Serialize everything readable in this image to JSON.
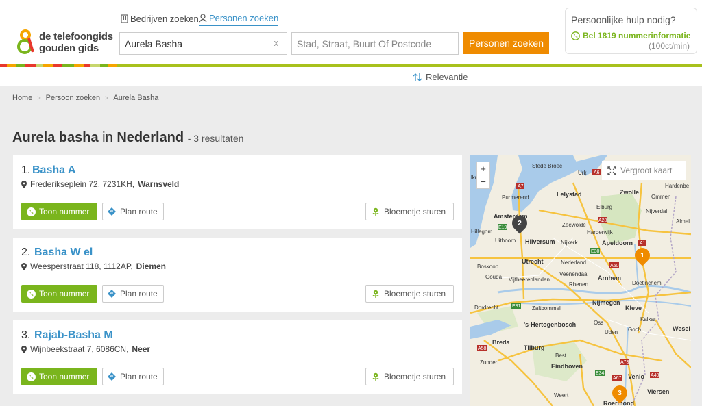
{
  "logo": {
    "line1": "de telefoongids",
    "line2": "gouden gids"
  },
  "tabs": [
    {
      "label": "Bedrijven zoeken",
      "icon": "building-icon",
      "active": false
    },
    {
      "label": "Personen zoeken",
      "icon": "person-icon",
      "active": true
    }
  ],
  "search": {
    "query_value": "Aurela Basha",
    "clear_label": "x",
    "location_placeholder": "Stad, Straat, Buurt Of Postcode",
    "button_label": "Personen zoeken"
  },
  "help": {
    "title": "Persoonlijke hulp nodig?",
    "link_label": "Bel 1819 nummerinformatie",
    "cost": "(100ct/min)"
  },
  "sort": {
    "label": "Relevantie"
  },
  "breadcrumb": [
    "Home",
    "Persoon zoeken",
    "Aurela Basha"
  ],
  "heading": {
    "name": "Aurela basha",
    "in": "in",
    "country": "Nederland",
    "count": "- 3 resultaten"
  },
  "results": [
    {
      "num": "1.",
      "name": "Basha A",
      "street": "Frederikseplein 72, 7231KH,",
      "city": "Warnsveld"
    },
    {
      "num": "2.",
      "name": "Basha W el",
      "street": "Weesperstraat 118, 1112AP,",
      "city": "Diemen"
    },
    {
      "num": "3.",
      "name": "Rajab-Basha M",
      "street": "Wijnbeekstraat 7, 6086CN,",
      "city": "Neer"
    }
  ],
  "actions": {
    "call": "Toon nummer",
    "route": "Plan route",
    "flowers": "Bloemetje sturen"
  },
  "map": {
    "zoom_in": "+",
    "zoom_out": "−",
    "enlarge_label": "Vergroot kaart",
    "cities": {
      "stedebroec": "Stede Broec",
      "urk": "Urk",
      "alkmaar": "lkmaar",
      "purmerend": "Purmerend",
      "lelystad": "Lelystad",
      "zwolle": "Zwolle",
      "ommen": "Ommen",
      "hardenberg": "Hardenbe",
      "elburg": "Elburg",
      "amsterdam": "Amsterdam",
      "zeewolde": "Zeewolde",
      "nijverdal": "Nijverdal",
      "hillegom": "Hillegom",
      "harderwijk": "Harderwijk",
      "almelo": "Almel",
      "uithoorn": "Uithoorn",
      "hilversum": "Hilversum",
      "nijkerk": "Nijkerk",
      "apeldoorn": "Apeldoorn",
      "boskoop": "Boskoop",
      "utrecht": "Utrecht",
      "nederland": "Nederland",
      "veenendaal": "Veenendaal",
      "arnhem": "Arnhem",
      "doetinchem": "Doetinchem",
      "gouda": "Gouda",
      "vijfheerenlanden": "Vijfheerenlanden",
      "rhenen": "Rhenen",
      "nijmegen": "Nijmegen",
      "kleve": "Kleve",
      "dordrecht": "Dordrecht",
      "zaltbommel": "Zaltbommel",
      "hertogenbosch": "'s-Hertogenbosch",
      "breda": "Breda",
      "tilburg": "Tilburg",
      "eindhoven": "Eindhoven",
      "venlo": "Venlo",
      "roermond": "Roermond",
      "weert": "Weert",
      "viersen": "Viersen",
      "goch": "Goch",
      "kalkar": "Kalkar",
      "wesel": "Wesel",
      "zundert": "Zundert",
      "oss": "Oss",
      "uden": "Uden",
      "best": "Best"
    },
    "markers": [
      {
        "label": "2",
        "color": "#444444"
      },
      {
        "label": "1",
        "color": "#ef8b00"
      },
      {
        "label": "3",
        "color": "#ef8b00"
      }
    ]
  },
  "colors": {
    "accent": "#3a92c8",
    "green": "#7ab51d",
    "orange": "#ef8b00"
  }
}
